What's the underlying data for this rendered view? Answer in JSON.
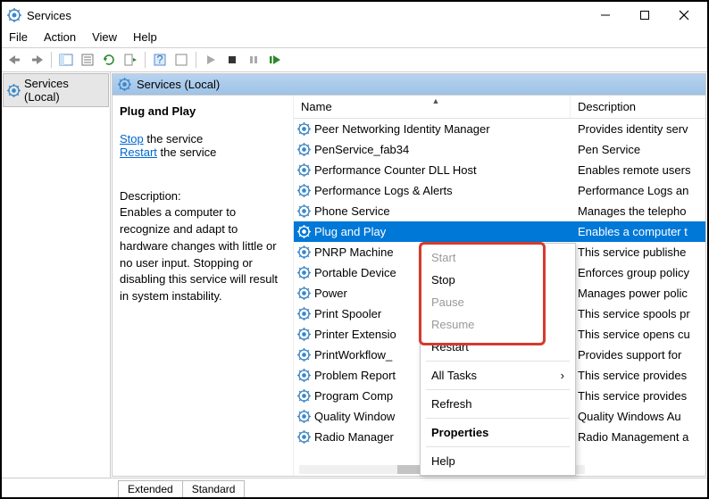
{
  "title": "Services",
  "menu": {
    "file": "File",
    "action": "Action",
    "view": "View",
    "help": "Help"
  },
  "tree_label": "Services (Local)",
  "pane_title": "Services (Local)",
  "side": {
    "selected": "Plug and Play",
    "stop_link": "Stop",
    "stop_rest": " the service",
    "restart_link": "Restart",
    "restart_rest": " the service",
    "desc_label": "Description:",
    "desc_text": "Enables a computer to recognize and adapt to hardware changes with little or no user input. Stopping or disabling this service will result in system instability."
  },
  "columns": {
    "name": "Name",
    "description": "Description"
  },
  "services": [
    {
      "name": "Peer Networking Identity Manager",
      "desc": "Provides identity serv"
    },
    {
      "name": "PenService_fab34",
      "desc": "Pen Service"
    },
    {
      "name": "Performance Counter DLL Host",
      "desc": "Enables remote users"
    },
    {
      "name": "Performance Logs & Alerts",
      "desc": "Performance Logs an"
    },
    {
      "name": "Phone Service",
      "desc": "Manages the telepho"
    },
    {
      "name": "Plug and Play",
      "desc": "Enables a computer t",
      "selected": true
    },
    {
      "name": "PNRP Machine",
      "desc": "This service publishe"
    },
    {
      "name": "Portable Device",
      "desc": "Enforces group policy"
    },
    {
      "name": "Power",
      "desc": "Manages power polic"
    },
    {
      "name": "Print Spooler",
      "desc": "This service spools pr"
    },
    {
      "name": "Printer Extensio",
      "desc": "This service opens cu"
    },
    {
      "name": "PrintWorkflow_",
      "desc": "Provides support for"
    },
    {
      "name": "Problem Report",
      "desc": "This service provides"
    },
    {
      "name": "Program Comp",
      "desc": "This service provides"
    },
    {
      "name": "Quality Window",
      "desc": "Quality Windows Au"
    },
    {
      "name": "Radio Manager",
      "desc": "Radio Management a"
    }
  ],
  "ctx": {
    "start": "Start",
    "stop": "Stop",
    "pause": "Pause",
    "resume": "Resume",
    "restart": "Restart",
    "all_tasks": "All Tasks",
    "refresh": "Refresh",
    "properties": "Properties",
    "help": "Help"
  },
  "tabs": {
    "extended": "Extended",
    "standard": "Standard"
  }
}
